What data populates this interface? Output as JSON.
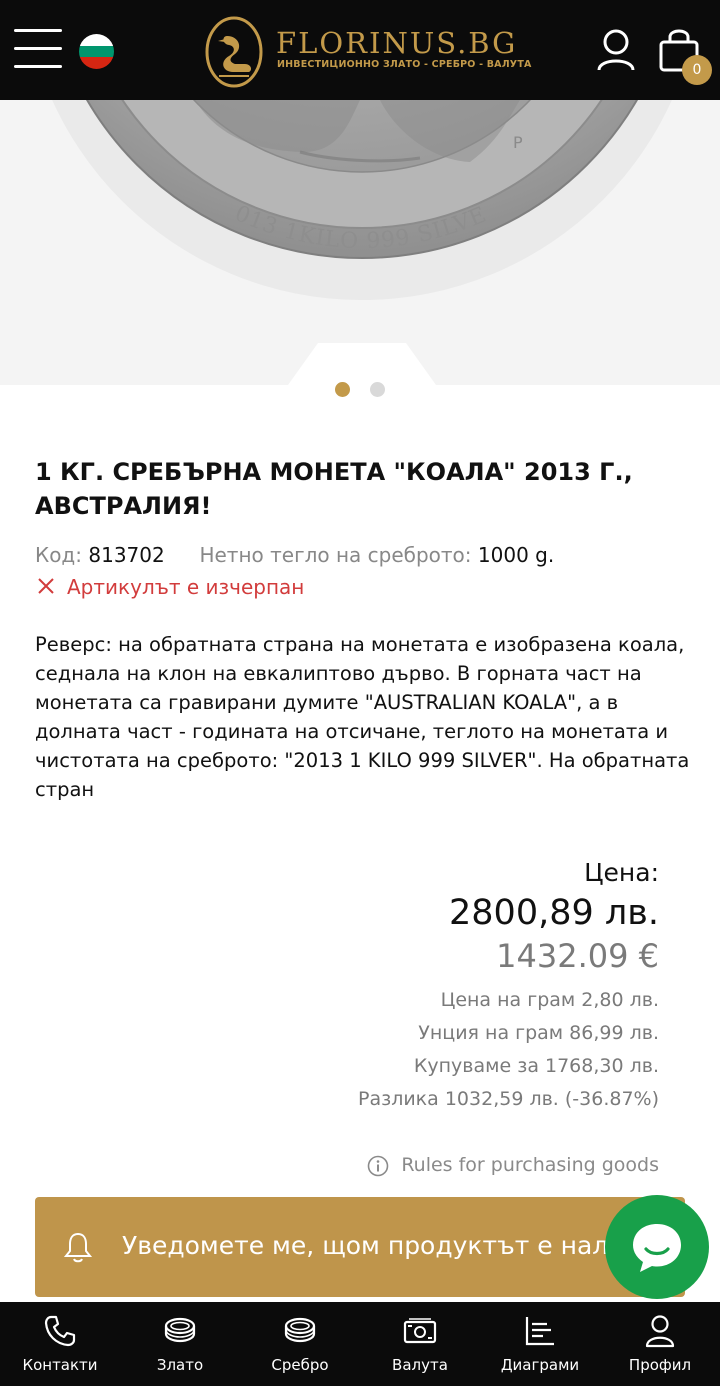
{
  "header": {
    "logo_text": "FLORINUS.BG",
    "logo_subtitle": "ИНВЕСТИЦИОННО ЗЛАТО - СРЕБРО - ВАЛУТА",
    "cart_count": "0",
    "flag_colors": [
      "#ffffff",
      "#00966e",
      "#d62612"
    ]
  },
  "hero": {
    "coin_inscription": "2013 1KILO 999 SILVER",
    "mint_mark": "P",
    "slides_total": 2,
    "active_slide": 1
  },
  "product": {
    "title": "1 КГ. СРЕБЪРНА МОНЕТА \"КОАЛА\" 2013 Г., АВСТРАЛИЯ!",
    "code_label": "Код:",
    "code_value": "813702",
    "weight_label": "Нетно тегло на среброто:",
    "weight_value": "1000 g.",
    "stock_status": "Артикулът е изчерпан",
    "description": "Реверс: на обратната страна на монетата е изобразена коала, седнала на клон на евкалиптово дърво. В горната част на монетата са гравирани думите \"AUSTRALIAN KOALA\", а в долната част - годината на отсичане, теглото на монетата и чистотата на среброто: \"2013 1 KILO 999 SILVER\". На обратната стран"
  },
  "pricing": {
    "label": "Цена:",
    "price_bgn": "2800,89 лв.",
    "price_eur": "1432.09 €",
    "per_gram": "Цена на грам 2,80 лв.",
    "ounce": "Унция на грам 86,99 лв.",
    "buyback": "Купуваме за 1768,30 лв.",
    "difference": "Разлика 1032,59 лв. (-36.87%)",
    "rules_link": "Rules for purchasing goods"
  },
  "notify_button": {
    "label": "Уведомете ме, щом продуктът е наличен"
  },
  "bottom_nav": [
    {
      "label": "Контакти",
      "icon": "phone-icon"
    },
    {
      "label": "Злато",
      "icon": "gold-coins-icon"
    },
    {
      "label": "Сребро",
      "icon": "silver-coins-icon"
    },
    {
      "label": "Валута",
      "icon": "banknote-icon"
    },
    {
      "label": "Диаграми",
      "icon": "chart-icon"
    },
    {
      "label": "Профил",
      "icon": "user-icon"
    }
  ],
  "colors": {
    "accent_gold": "#c39a4a",
    "button_gold": "#bf954b",
    "chat_green": "#18a04a",
    "out_of_stock_red": "#d23c3c",
    "header_bg": "#0b0b0b"
  }
}
